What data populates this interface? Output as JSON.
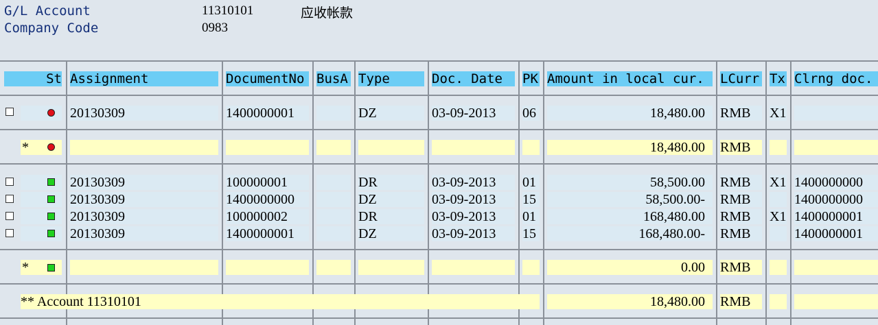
{
  "header": {
    "gl_label": "G/L Account",
    "gl_value": "11310101",
    "gl_desc": "应收帐款",
    "cc_label": "Company Code",
    "cc_value": "0983"
  },
  "columns": {
    "st": "St",
    "assignment": "Assignment",
    "docno": "DocumentNo",
    "busa": "BusA",
    "type": "Type",
    "docdate": "Doc. Date",
    "pk": "PK",
    "amount": "Amount in local cur.",
    "lcurr": "LCurr",
    "tx": "Tx",
    "clrng": "Clrng doc."
  },
  "rows": [
    {
      "assignment": "20130309",
      "docno": "1400000001",
      "busa": "",
      "type": "DZ",
      "docdate": "03-09-2013",
      "pk": "06",
      "amount": "18,480.00",
      "lcurr": "RMB",
      "tx": "X1",
      "clrng": ""
    },
    {
      "assignment": "20130309",
      "docno": "100000001",
      "busa": "",
      "type": "DR",
      "docdate": "03-09-2013",
      "pk": "01",
      "amount": "58,500.00",
      "lcurr": "RMB",
      "tx": "X1",
      "clrng": "1400000000"
    },
    {
      "assignment": "20130309",
      "docno": "1400000000",
      "busa": "",
      "type": "DZ",
      "docdate": "03-09-2013",
      "pk": "15",
      "amount": "58,500.00-",
      "lcurr": "RMB",
      "tx": "",
      "clrng": "1400000000"
    },
    {
      "assignment": "20130309",
      "docno": "100000002",
      "busa": "",
      "type": "DR",
      "docdate": "03-09-2013",
      "pk": "01",
      "amount": "168,480.00",
      "lcurr": "RMB",
      "tx": "X1",
      "clrng": "1400000001"
    },
    {
      "assignment": "20130309",
      "docno": "1400000001",
      "busa": "",
      "type": "DZ",
      "docdate": "03-09-2013",
      "pk": "15",
      "amount": "168,480.00-",
      "lcurr": "RMB",
      "tx": "",
      "clrng": "1400000001"
    }
  ],
  "subtotals": [
    {
      "marker": "*",
      "amount": "18,480.00",
      "lcurr": "RMB"
    },
    {
      "marker": "*",
      "amount": "0.00",
      "lcurr": "RMB"
    }
  ],
  "total": {
    "label": "** Account 11310101",
    "amount": "18,480.00",
    "lcurr": "RMB"
  },
  "status_colors": {
    "open": "#e0101a",
    "cleared": "#1fd11f"
  }
}
